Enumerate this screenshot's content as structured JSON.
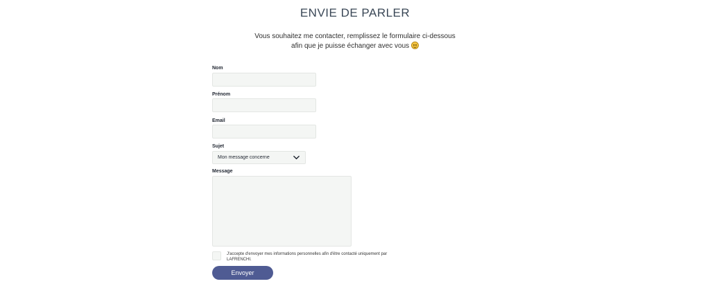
{
  "header": {
    "title": "ENVIE DE PARLER",
    "intro_line1": "Vous souhaitez me contacter, remplissez le formulaire ci-dessous",
    "intro_line2": "afin que je puisse échanger avec vous"
  },
  "form": {
    "nom": {
      "label": "Nom",
      "value": ""
    },
    "prenom": {
      "label": "Prénom",
      "value": ""
    },
    "email": {
      "label": "Email",
      "value": ""
    },
    "sujet": {
      "label": "Sujet",
      "selected": "Mon message concerne"
    },
    "message": {
      "label": "Message",
      "value": ""
    },
    "consent_text": "J'accepte d'envoyer mes informations personnelles afin d'être contacté uniquement par LAFRENCHI.",
    "submit_label": "Envoyer"
  },
  "icons": {
    "emoji": "smiley-icon",
    "select": "chevron-down-icon"
  },
  "colors": {
    "button": "#4f5b93",
    "title": "#3a4756",
    "field_bg": "#f4f6f4"
  }
}
